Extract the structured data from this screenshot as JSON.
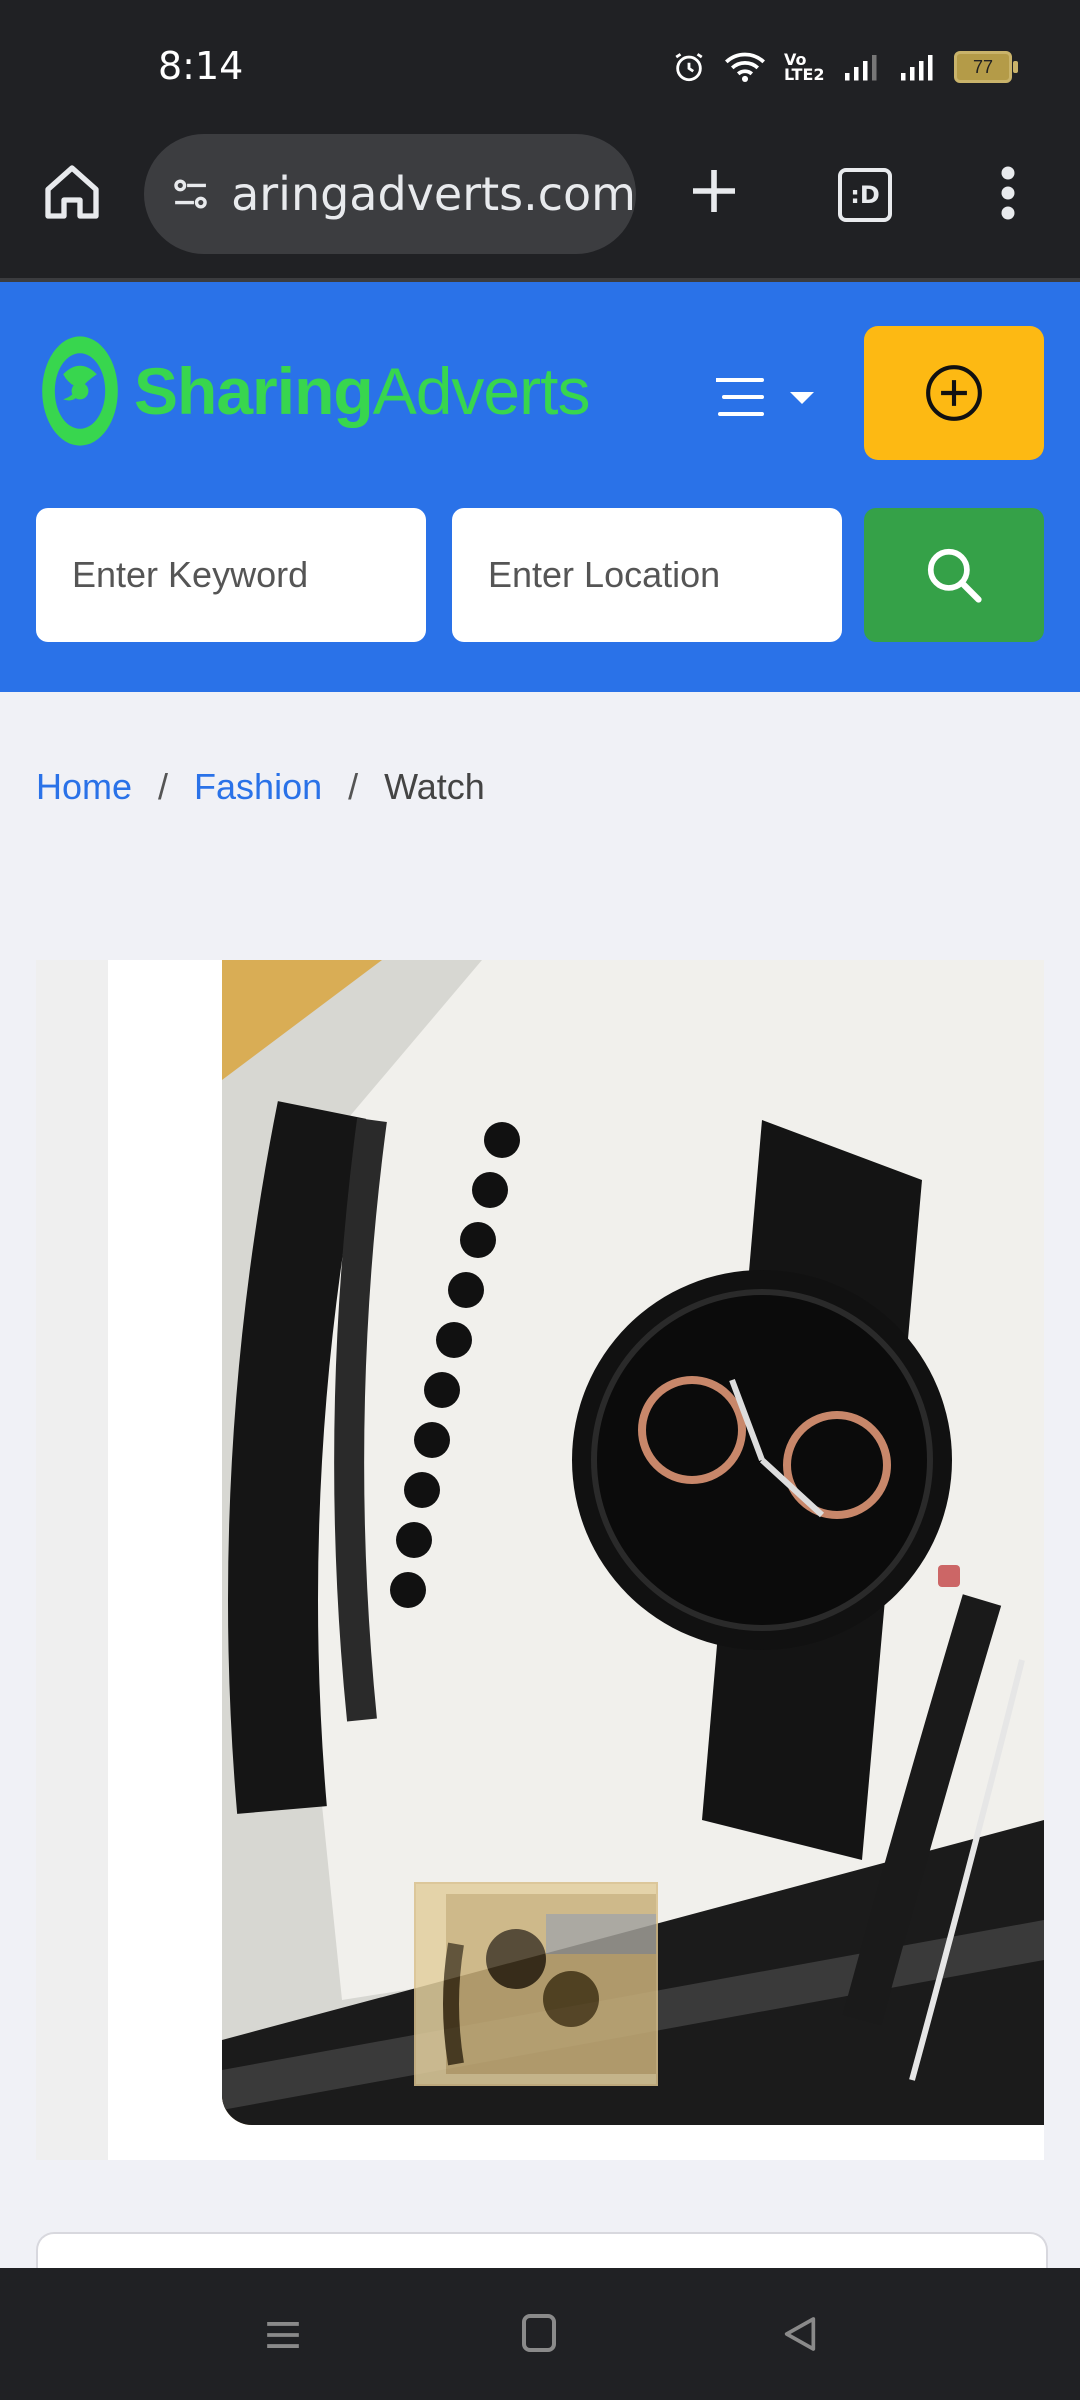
{
  "status_bar": {
    "time": "8:14",
    "battery": "77",
    "volte": "Vo LTE2"
  },
  "browser": {
    "url": "aringadverts.com",
    "tabs_label": ":D"
  },
  "site": {
    "logo_bold": "Sharing",
    "logo_thin": "Adverts",
    "keyword_placeholder": "Enter Keyword",
    "location_placeholder": "Enter Location"
  },
  "breadcrumb": {
    "home": "Home",
    "separator": "/",
    "category": "Fashion",
    "current": "Watch"
  },
  "colors": {
    "header_blue": "#2a72e8",
    "post_ad_yellow": "#fdb913",
    "search_green": "#35a148",
    "logo_green": "#38d64e",
    "page_bg": "#f0f1f6"
  },
  "icons": {
    "home": "home-icon",
    "site_settings": "tune-icon",
    "new_tab": "plus-icon",
    "overflow_menu": "more-vert-icon",
    "nav_menu": "hamburger-icon",
    "post_ad": "plus-circle-icon",
    "search": "search-icon"
  }
}
